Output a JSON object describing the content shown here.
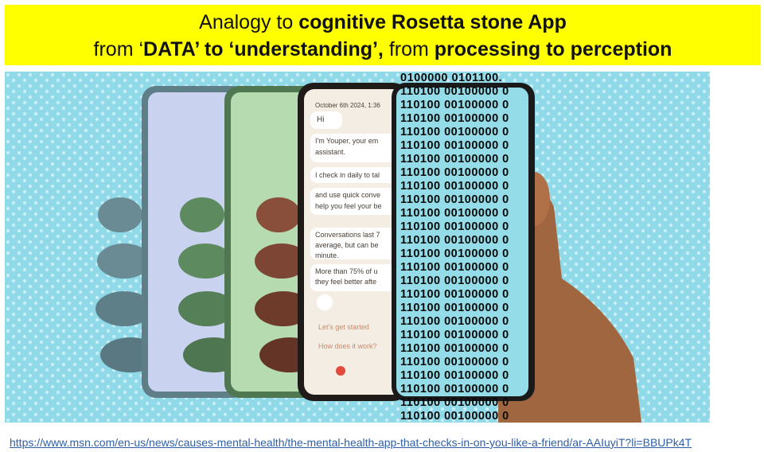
{
  "title": {
    "line1": [
      {
        "text": "Analogy to ",
        "bold": false
      },
      {
        "text": "cognitive Rosetta stone App",
        "bold": true
      }
    ],
    "line2": [
      {
        "text": "from ‘",
        "bold": false
      },
      {
        "text": "DATA’ to ‘understanding’,",
        "bold": true
      },
      {
        "text": " from ",
        "bold": false
      },
      {
        "text": "processing to perception",
        "bold": true
      }
    ]
  },
  "binary_lines": [
    "0100000 0101100.",
    "110100 00100000 0",
    "110100 00100000 0",
    "110100 00100000 0",
    "110100 00100000 0",
    "110100 00100000 0",
    "110100 00100000 0",
    "110100 00100000 0",
    "110100 00100000 0",
    "110100 00100000 0",
    "110100 00100000 0",
    "110100 00100000 0",
    "110100 00100000 0",
    "110100 00100000 0",
    "110100 00100000 0",
    "110100 00100000 0",
    "110100 00100000 0",
    "110100 00100000 0",
    "110100 00100000 0",
    "110100 00100000 0",
    "110100 00100000 0",
    "110100 00100000 0",
    "110100 00100000 0",
    "110100 00100000 0",
    "110100 00100000 0",
    "110100 00100000 0"
  ],
  "phone_ui": {
    "date": "October 6th 2024, 1:36",
    "greeting": "Hi",
    "intro": "I'm Youper, your em",
    "intro2": "assistant.",
    "checkin": "I check in daily to tal",
    "quick": "and use quick conve",
    "quick2": "help you feel your be",
    "conversations": "Conversations last 7",
    "conversations2": "average, but can be",
    "conversations3": "minute.",
    "more": "More than 75% of u",
    "more2": "they feel better afte",
    "started": "Let's get started",
    "how": "How does it work?"
  },
  "colors": {
    "banner": "#ffff00",
    "background": "#8fd9e8",
    "dots": "#c8eef6",
    "link": "#2e5fa8"
  },
  "source_link": "https://www.msn.com/en-us/news/causes-mental-health/the-mental-health-app-that-checks-in-on-you-like-a-friend/ar-AAIuyiT?li=BBUPk4T"
}
